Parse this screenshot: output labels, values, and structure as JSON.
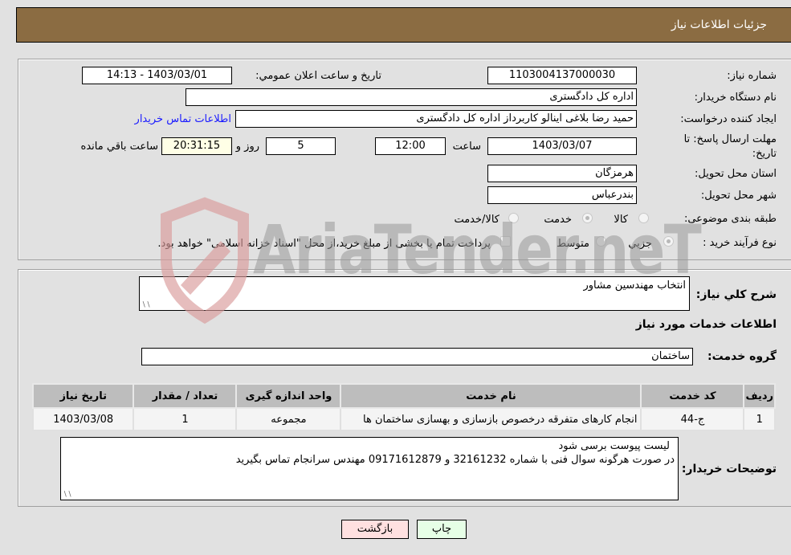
{
  "header": {
    "title": "جزئیات اطلاعات نیاز"
  },
  "form": {
    "need_number_label": "شماره نیاز:",
    "need_number": "1103004137000030",
    "announce_label": "تاريخ و ساعت اعلان عمومي:",
    "announce_value": "1403/03/01 - 14:13",
    "buyer_org_label": "نام دستگاه خريدار:",
    "buyer_org": "اداره کل دادگستری",
    "creator_label": "ايجاد کننده درخواست:",
    "creator": "حمید رضا  بلاغی اینالو کاربرداز اداره کل دادگستری",
    "contact_link": "اطلاعات تماس خريدار",
    "deadline_label": "مهلت ارسال پاسخ: تا تاريخ:",
    "deadline_date": "1403/03/07",
    "time_label": "ساعت",
    "deadline_time": "12:00",
    "days_value": "5",
    "days_label": "روز و",
    "remaining_time": "20:31:15",
    "remaining_label": "ساعت باقي مانده",
    "province_label": "استان محل تحويل:",
    "province": "هرمزگان",
    "city_label": "شهر محل تحويل:",
    "city": "بندرعباس",
    "category_label": "طبقه بندی موضوعی:",
    "category_options": [
      {
        "label": "کالا",
        "selected": false
      },
      {
        "label": "خدمت",
        "selected": true
      },
      {
        "label": "کالا/خدمت",
        "selected": false
      }
    ],
    "purchase_type_label": "نوع فرآيند خريد :",
    "purchase_options": [
      {
        "label": "جزيي",
        "selected": true
      },
      {
        "label": "متوسط",
        "selected": false
      }
    ],
    "treasury_note": "پرداخت تمام يا بخشی از مبلغ خريد،از محل \"اسناد خزانه اسلامی\" خواهد بود."
  },
  "details": {
    "summary_label": "شرح کلي نياز:",
    "summary": "انتخاب مهندسین مشاور",
    "services_title": "اطلاعات خدمات مورد نياز",
    "service_group_label": "گروه خدمت:",
    "service_group": "ساختمان",
    "table": {
      "headers": [
        "رديف",
        "کد خدمت",
        "نام خدمت",
        "واحد اندازه گيری",
        "تعداد / مقدار",
        "تاريخ نياز"
      ],
      "rows": [
        [
          "1",
          "ج-44",
          "انجام کارهای متفرقه درخصوص بازسازی و بهسازی ساختمان ها",
          "مجموعه",
          "1",
          "1403/03/08"
        ]
      ]
    },
    "buyer_notes_label": "توضيحات خريدار:",
    "buyer_notes_line1": "لیست پیوست برسی شود",
    "buyer_notes_line2": "در صورت هرگونه سوال فنی با شماره 32161232 و 09171612879 مهندس سرانجام تماس بگیرید"
  },
  "buttons": {
    "print": "چاپ",
    "back": "بازگشت"
  },
  "watermark": {
    "text": "AriaTender.neT"
  },
  "colors": {
    "header": "#8b6c42",
    "link": "#1a1aff",
    "print_bg": "#e6ffe6",
    "back_bg": "#ffe0e0",
    "remaining_bg": "#ffffe6"
  }
}
